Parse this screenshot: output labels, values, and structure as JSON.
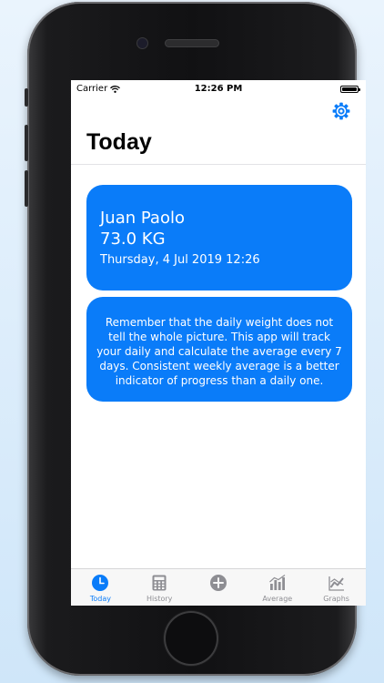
{
  "status_bar": {
    "carrier": "Carrier",
    "time": "12:26 PM"
  },
  "header": {
    "title": "Today",
    "settings_icon": "gear-icon"
  },
  "weight_card": {
    "name": "Juan Paolo",
    "weight": "73.0 KG",
    "date": "Thursday, 4 Jul 2019 12:26"
  },
  "tip_card": {
    "text": "Remember that the daily weight does not tell the whole picture. This app will track your daily and calculate the average every 7 days. Consistent weekly average is a better indicator of progress than a daily one."
  },
  "tabs": [
    {
      "label": "Today",
      "icon": "clock-icon",
      "active": true
    },
    {
      "label": "History",
      "icon": "calculator-icon",
      "active": false
    },
    {
      "label": "",
      "icon": "add-circle-icon",
      "active": false
    },
    {
      "label": "Average",
      "icon": "bar-chart-icon",
      "active": false
    },
    {
      "label": "Graphs",
      "icon": "line-graph-icon",
      "active": false
    }
  ],
  "colors": {
    "accent": "#0a7cf9",
    "tab_inactive": "#8e8e93",
    "card_text": "#ffffff"
  }
}
